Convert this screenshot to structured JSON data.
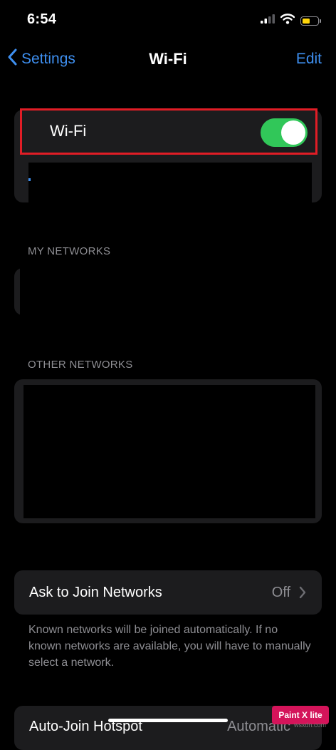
{
  "status_bar": {
    "time": "6:54"
  },
  "nav": {
    "back_label": "Settings",
    "title": "Wi-Fi",
    "edit_label": "Edit"
  },
  "wifi": {
    "label": "Wi-Fi",
    "enabled": true,
    "toggle_color": "#31c759"
  },
  "sections": {
    "my_networks": "MY NETWORKS",
    "other_networks": "OTHER NETWORKS"
  },
  "ask_to_join": {
    "label": "Ask to Join Networks",
    "value": "Off",
    "footnote": "Known networks will be joined automatically. If no known networks are available, you will have to manually select a network."
  },
  "auto_join": {
    "label": "Auto-Join Hotspot",
    "value": "Automatic"
  },
  "watermark": {
    "text": "Paint X lite",
    "subtext": "wsxdn.com"
  },
  "colors": {
    "accent": "#3e8ff0",
    "highlight": "#e11d26",
    "card": "#1c1c1e",
    "secondary_text": "#8e8e93"
  },
  "icons": [
    "cellular-signal-icon",
    "wifi-icon",
    "battery-icon",
    "chevron-left-icon",
    "chevron-right-icon"
  ]
}
